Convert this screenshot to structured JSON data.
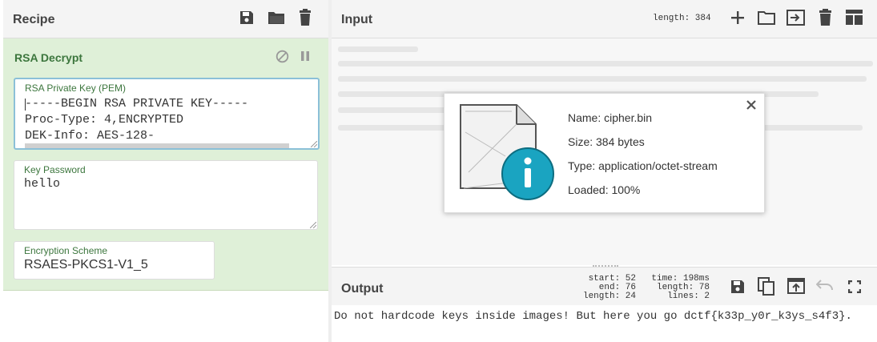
{
  "recipe": {
    "title": "Recipe",
    "operation": {
      "title": "RSA Decrypt",
      "private_key": {
        "label": "RSA Private Key (PEM)",
        "lines": [
          "-----BEGIN RSA PRIVATE KEY-----",
          "Proc-Type: 4,ENCRYPTED",
          "DEK-Info: AES-128-"
        ]
      },
      "key_password": {
        "label": "Key Password",
        "value": "hello"
      },
      "encryption_scheme": {
        "label": "Encryption Scheme",
        "value": "RSAES-PKCS1-V1_5"
      }
    }
  },
  "input": {
    "title": "Input",
    "length_label": "length: 384",
    "file": {
      "name": "Name: cipher.bin",
      "size": "Size: 384 bytes",
      "type": "Type: application/octet-stream",
      "loaded": "Loaded: 100%"
    }
  },
  "output": {
    "title": "Output",
    "stats": {
      "start": "start: 52",
      "end": "end: 76",
      "length": "length: 24",
      "time": "time: 198ms",
      "total_length": "length:   78",
      "lines": "lines:    2"
    },
    "text": "Do not hardcode keys inside images! But here you go dctf{k33p_y0r_k3ys_s4f3}."
  },
  "colors": {
    "operation_bg": "#dff0d8",
    "operation_title": "#3c763d",
    "info_teal": "#1aa4c1"
  }
}
